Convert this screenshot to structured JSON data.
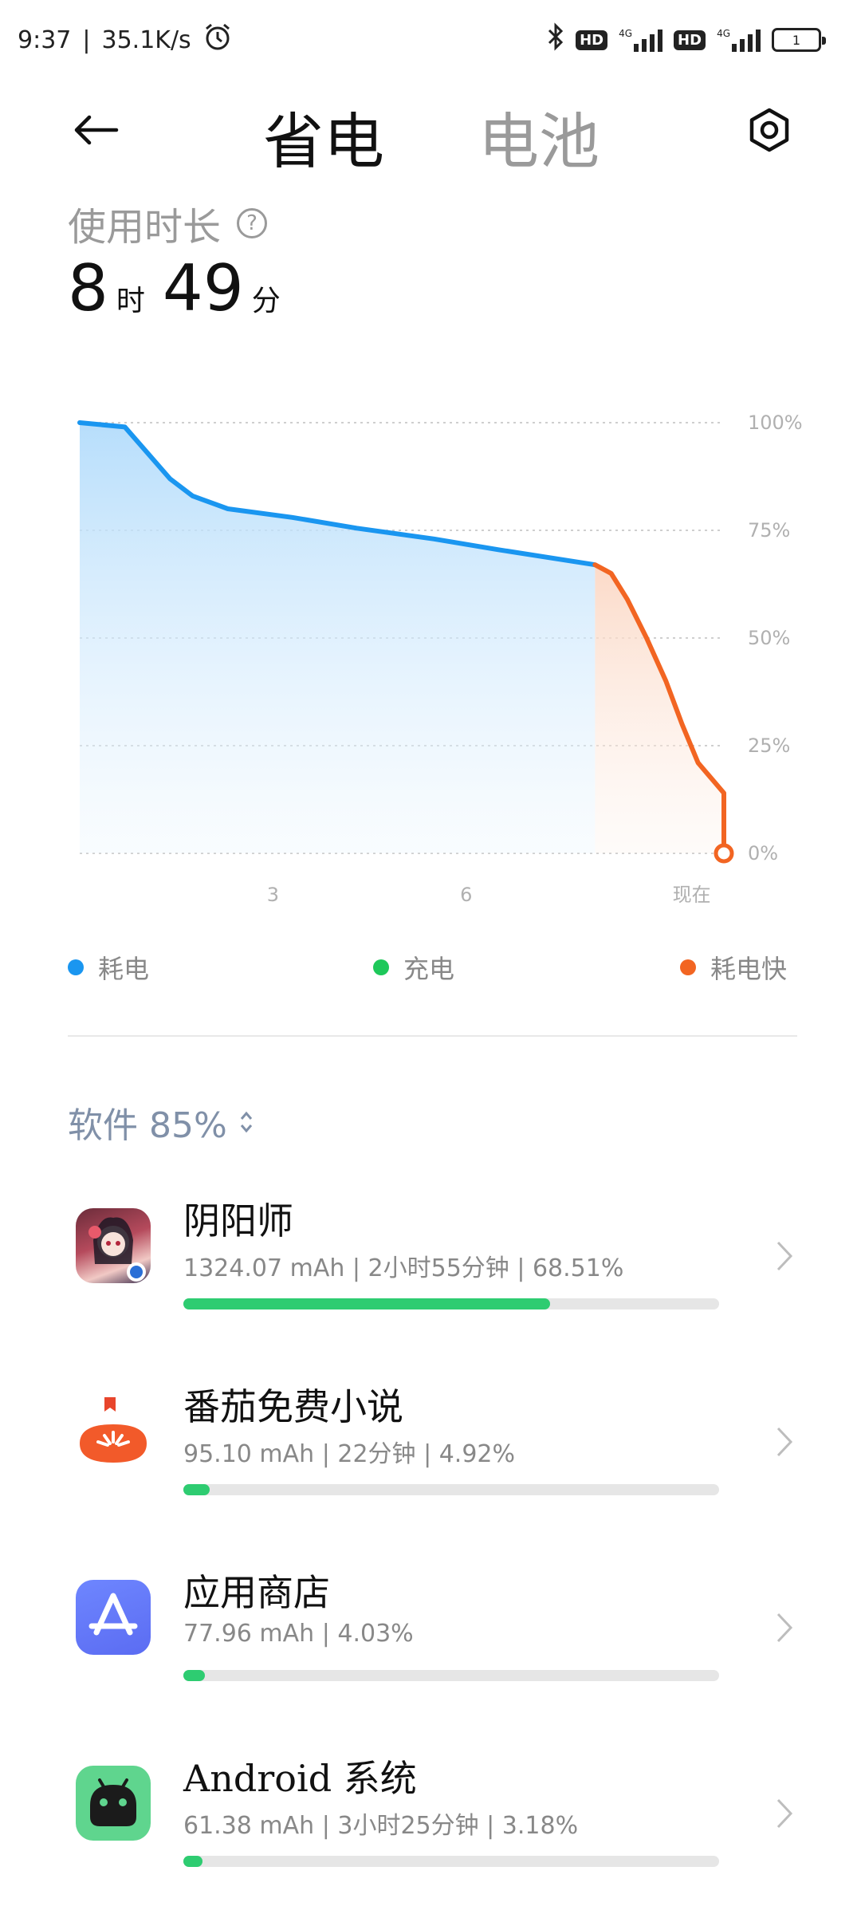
{
  "status": {
    "time": "9:37",
    "speed": "35.1K/s",
    "hd1": "HD",
    "hd2": "HD",
    "net1": "4G",
    "net2": "4G",
    "battery_text": "1"
  },
  "header": {
    "tab_active": "省电",
    "tab_inactive": "电池"
  },
  "usage": {
    "label": "使用时长",
    "help_glyph": "?",
    "hours": "8",
    "hours_unit": "时",
    "minutes": "49",
    "minutes_unit": "分"
  },
  "chart_data": {
    "type": "area",
    "y_tick_labels": [
      "100%",
      "75%",
      "50%",
      "25%",
      "0%"
    ],
    "x_tick_labels": [
      "3",
      "6",
      "现在"
    ],
    "ylim": [
      0,
      100
    ],
    "series": [
      {
        "name": "耗电",
        "color": "#1a96f0",
        "points": [
          [
            0,
            100
          ],
          [
            0.7,
            99
          ],
          [
            1.4,
            87
          ],
          [
            1.75,
            83
          ],
          [
            2.3,
            80
          ],
          [
            3.3,
            78
          ],
          [
            4.3,
            75.5
          ],
          [
            5.5,
            73
          ],
          [
            6.5,
            70.5
          ],
          [
            8.0,
            67
          ]
        ]
      },
      {
        "name": "耗电快",
        "color": "#f26522",
        "points": [
          [
            8.0,
            67
          ],
          [
            8.25,
            65
          ],
          [
            8.5,
            59
          ],
          [
            8.8,
            50
          ],
          [
            9.1,
            40
          ],
          [
            9.35,
            30
          ],
          [
            9.6,
            21
          ],
          [
            10.0,
            14
          ],
          [
            10.0,
            0
          ]
        ]
      }
    ],
    "x_range": [
      0,
      10
    ],
    "x_tick_positions": [
      3,
      6,
      9.5
    ],
    "grid": true
  },
  "legend": [
    {
      "label": "耗电",
      "color": "#1a96f0"
    },
    {
      "label": "充电",
      "color": "#1ec85a"
    },
    {
      "label": "耗电快",
      "color": "#f26522"
    }
  ],
  "section": {
    "title": "软件 85%"
  },
  "apps": [
    {
      "name": "阴阳师",
      "stats": "1324.07 mAh | 2小时55分钟 | 68.51%",
      "percent": 68.51,
      "icon": "onmyoji-app-icon"
    },
    {
      "name": "番茄免费小说",
      "stats": "95.10 mAh | 22分钟 | 4.92%",
      "percent": 4.92,
      "icon": "tomato-novel-app-icon"
    },
    {
      "name": "应用商店",
      "stats": "77.96 mAh | 4.03%",
      "percent": 4.03,
      "icon": "app-store-icon"
    },
    {
      "name": "Android 系统",
      "stats": "61.38 mAh | 3小时25分钟 | 3.18%",
      "percent": 3.18,
      "icon": "android-system-icon"
    }
  ]
}
